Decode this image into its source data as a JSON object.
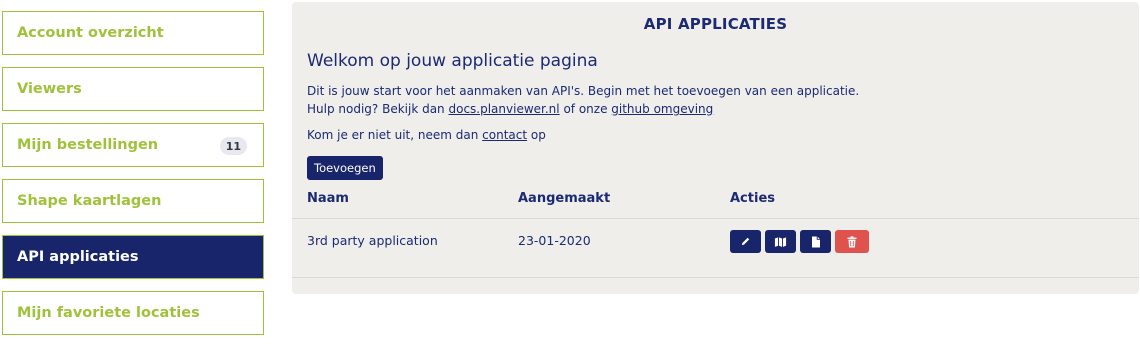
{
  "sidebar": {
    "items": [
      {
        "label": "Account overzicht",
        "active": false
      },
      {
        "label": "Viewers",
        "active": false
      },
      {
        "label": "Mijn bestellingen",
        "active": false,
        "badge": "11"
      },
      {
        "label": "Shape kaartlagen",
        "active": false
      },
      {
        "label": "API applicaties",
        "active": true
      },
      {
        "label": "Mijn favoriete locaties",
        "active": false
      }
    ]
  },
  "panel": {
    "title": "API APPLICATIES",
    "welcome": "Welkom op jouw applicatie pagina",
    "intro_line1": "Dit is jouw start voor het aanmaken van API's. Begin met het toevoegen van een applicatie.",
    "intro_line2_prefix": "Hulp nodig? Bekijk dan ",
    "docs_link": "docs.planviewer.nl",
    "intro_line2_middle": " of onze ",
    "github_link": "github omgeving",
    "contact_prefix": "Kom je er niet uit, neem dan ",
    "contact_link": "contact",
    "contact_suffix": " op",
    "add_button": "Toevoegen"
  },
  "table": {
    "headers": [
      "Naam",
      "Aangemaakt",
      "Acties"
    ],
    "rows": [
      {
        "name": "3rd party application",
        "created": "23-01-2020"
      }
    ],
    "action_icons": [
      "pencil-icon",
      "map-icon",
      "document-icon",
      "trash-icon"
    ]
  },
  "colors": {
    "accent_green": "#9fc23a",
    "navy": "#18256b",
    "danger": "#e0524d",
    "panel_bg": "#efeeeb"
  }
}
